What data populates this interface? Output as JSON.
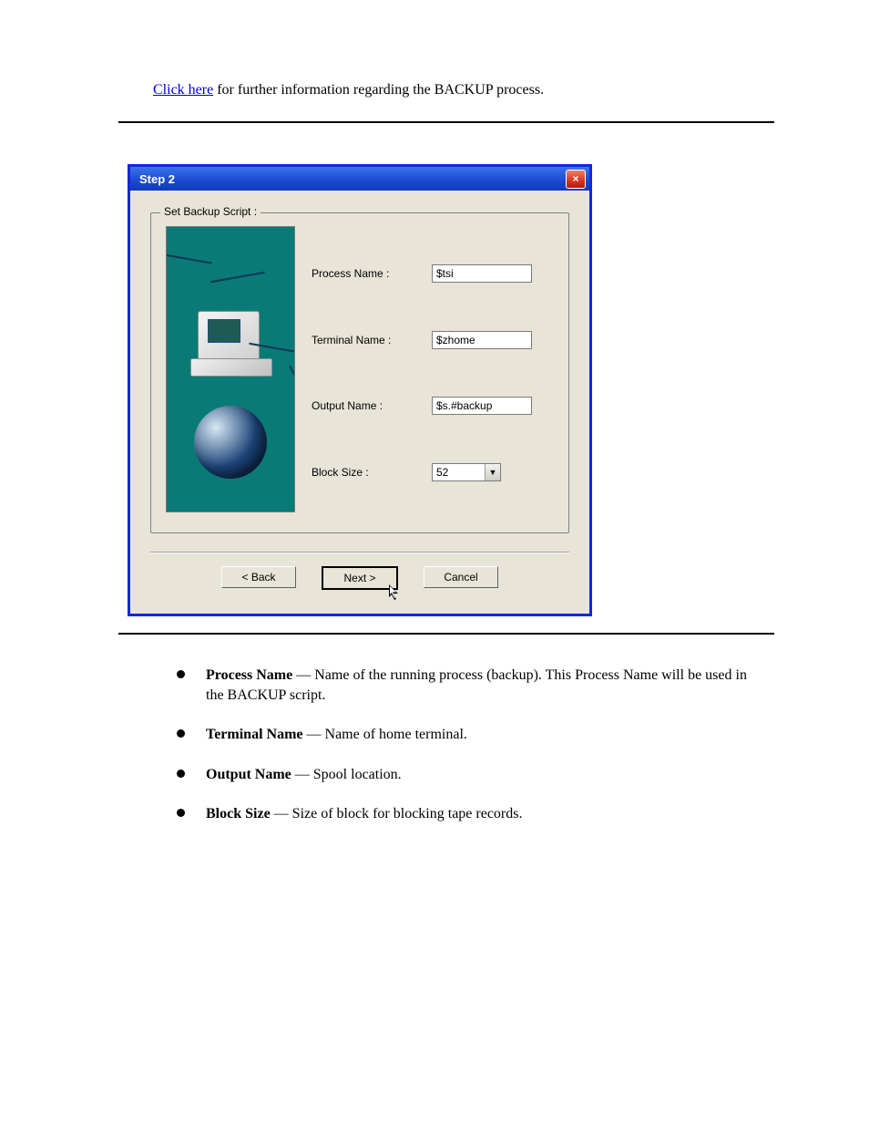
{
  "header": {
    "link_text": "Click here",
    "following_text": " for further information regarding the BACKUP process."
  },
  "dialog": {
    "title": "Step 2",
    "group_legend": "Set Backup Script :",
    "fields": {
      "process_name": {
        "label": "Process Name :",
        "value": "$tsi"
      },
      "terminal_name": {
        "label": "Terminal Name :",
        "value": "$zhome"
      },
      "output_name": {
        "label": "Output Name :",
        "value": "$s.#backup"
      },
      "block_size": {
        "label": "Block Size :",
        "value": "52"
      }
    },
    "buttons": {
      "back": "< Back",
      "next": "Next >",
      "cancel": "Cancel"
    },
    "close_icon": "×"
  },
  "bullets": {
    "b1_prefix": "Process Name",
    "b1_rest": " — Name of the running process (backup). This Process Name will be used in the BACKUP script.",
    "b2_prefix": "Terminal Name",
    "b2_rest": " — Name of home terminal.",
    "b3_prefix": "Output Name",
    "b3_rest": " — Spool location.",
    "b4_prefix": "Block Size",
    "b4_rest": " — Size of block for blocking tape records."
  }
}
